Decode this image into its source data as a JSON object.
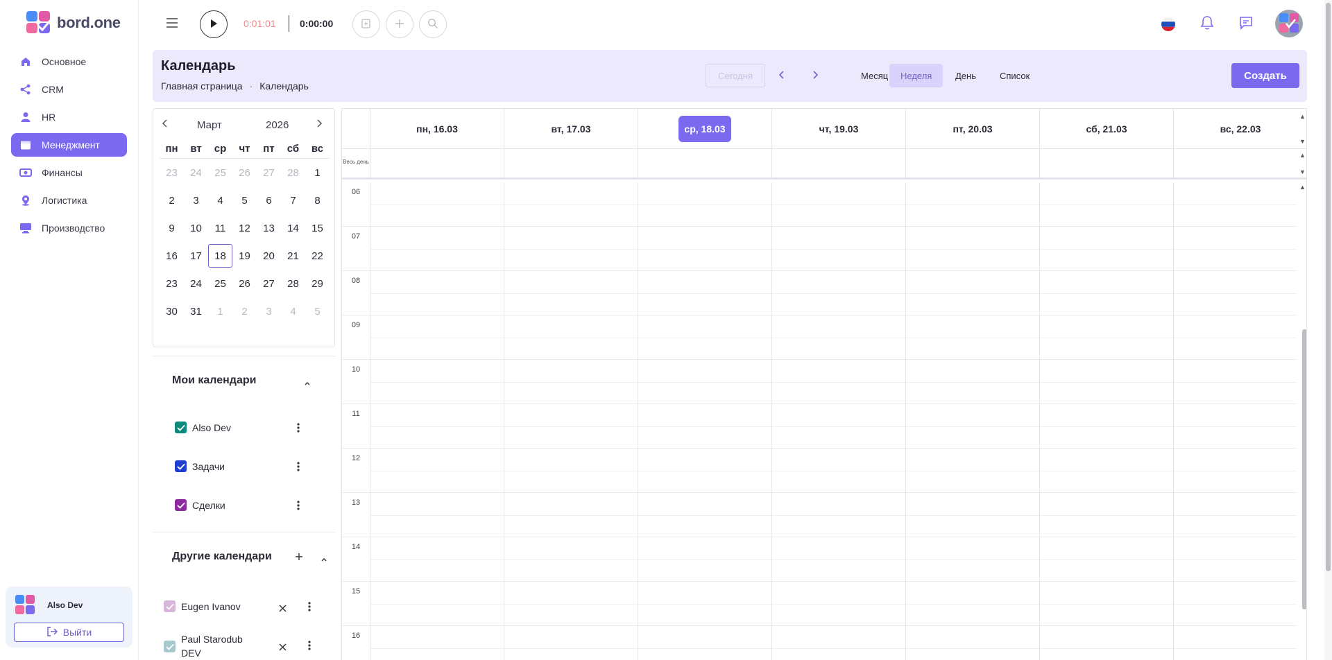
{
  "app": {
    "brand": "bord.one"
  },
  "sidebar": {
    "items": [
      {
        "label": "Основное",
        "icon": "home-icon"
      },
      {
        "label": "CRM",
        "icon": "share-icon"
      },
      {
        "label": "HR",
        "icon": "person-icon"
      },
      {
        "label": "Менеджмент",
        "icon": "calendar-icon",
        "active": true
      },
      {
        "label": "Финансы",
        "icon": "money-icon"
      },
      {
        "label": "Логистика",
        "icon": "location-icon"
      },
      {
        "label": "Производство",
        "icon": "monitor-icon"
      }
    ],
    "user": {
      "name": "Also Dev",
      "logout_label": "Выйти"
    }
  },
  "topbar": {
    "timer_session": "0:01:01",
    "timer_total": "0:00:00"
  },
  "header": {
    "title": "Календарь",
    "breadcrumb": [
      "Главная страница",
      "Календарь"
    ],
    "today_label": "Сегодня",
    "views": [
      "Месяц",
      "Неделя",
      "День",
      "Список"
    ],
    "active_view": "Неделя",
    "create_label": "Создать"
  },
  "mini_calendar": {
    "month": "Март",
    "year": "2026",
    "weekdays": [
      "пн",
      "вт",
      "ср",
      "чт",
      "пт",
      "сб",
      "вс"
    ],
    "weeks": [
      [
        "23",
        "24",
        "25",
        "26",
        "27",
        "28",
        "1"
      ],
      [
        "2",
        "3",
        "4",
        "5",
        "6",
        "7",
        "8"
      ],
      [
        "9",
        "10",
        "11",
        "12",
        "13",
        "14",
        "15"
      ],
      [
        "16",
        "17",
        "18",
        "19",
        "20",
        "21",
        "22"
      ],
      [
        "23",
        "24",
        "25",
        "26",
        "27",
        "28",
        "29"
      ],
      [
        "30",
        "31",
        "1",
        "2",
        "3",
        "4",
        "5"
      ]
    ],
    "today": "18"
  },
  "my_calendars": {
    "title": "Мои календари",
    "items": [
      {
        "label": "Also Dev",
        "color": "#0e8a7d"
      },
      {
        "label": "Задачи",
        "color": "#1f3fd0"
      },
      {
        "label": "Сделки",
        "color": "#8e2a9e"
      }
    ]
  },
  "other_calendars": {
    "title": "Другие календари",
    "items": [
      {
        "label": "Eugen Ivanov",
        "color": "#d9b6dc"
      },
      {
        "label": "Paul Starodub DEV",
        "color": "#a8c8cf"
      }
    ]
  },
  "week": {
    "days": [
      "пн, 16.03",
      "вт, 17.03",
      "ср, 18.03",
      "чт, 19.03",
      "пт, 20.03",
      "сб, 21.03",
      "вс, 22.03"
    ],
    "today_index": 2,
    "allday_label": "Весь день",
    "hours": [
      "06",
      "07",
      "08",
      "09",
      "10",
      "11",
      "12",
      "13",
      "14",
      "15",
      "16"
    ]
  },
  "colors": {
    "accent": "#7b6af0",
    "header_bg": "#ece9fd"
  }
}
